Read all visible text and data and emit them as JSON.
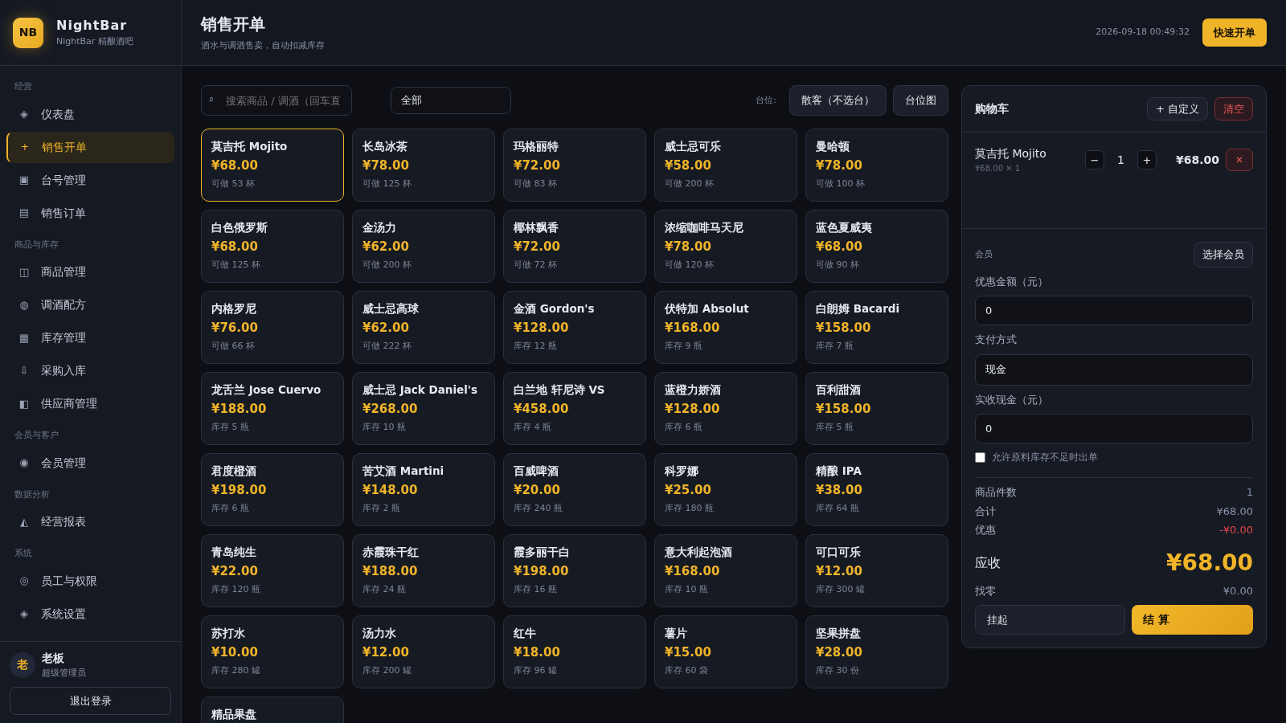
{
  "brand": {
    "logo": "NB",
    "name": "NightBar",
    "subtitle": "NightBar 精酿酒吧"
  },
  "sidebar": {
    "sections": [
      {
        "title": "经营",
        "items": [
          {
            "icon": "◈",
            "label": "仪表盘",
            "selected": false
          },
          {
            "icon": "+",
            "label": "销售开单",
            "selected": true
          },
          {
            "icon": "▣",
            "label": "台号管理",
            "selected": false
          },
          {
            "icon": "▤",
            "label": "销售订单",
            "selected": false
          }
        ]
      },
      {
        "title": "商品与库存",
        "items": [
          {
            "icon": "◫",
            "label": "商品管理",
            "selected": false
          },
          {
            "icon": "◍",
            "label": "调酒配方",
            "selected": false
          },
          {
            "icon": "▦",
            "label": "库存管理",
            "selected": false
          },
          {
            "icon": "⇩",
            "label": "采购入库",
            "selected": false
          },
          {
            "icon": "◧",
            "label": "供应商管理",
            "selected": false
          }
        ]
      },
      {
        "title": "会员与客户",
        "items": [
          {
            "icon": "◉",
            "label": "会员管理",
            "selected": false
          }
        ]
      },
      {
        "title": "数据分析",
        "items": [
          {
            "icon": "◭",
            "label": "经营报表",
            "selected": false
          }
        ]
      },
      {
        "title": "系统",
        "items": [
          {
            "icon": "◎",
            "label": "员工与权限",
            "selected": false
          },
          {
            "icon": "◈",
            "label": "系统设置",
            "selected": false
          }
        ]
      }
    ],
    "user": {
      "avatar": "老",
      "name": "老板",
      "role": "超级管理员"
    },
    "logout": "退出登录"
  },
  "header": {
    "title": "销售开单",
    "subtitle": "酒水与调酒售卖，自动扣减库存",
    "datetime": "2026-09-18 00:49:32",
    "action": "快速开单"
  },
  "toolbar": {
    "search_icon": "⌕",
    "search_placeholder": "搜索商品 / 调酒（回车直",
    "category": "全部",
    "table_label": "台位:",
    "table_value": "散客（不选台）",
    "table_map": "台位图"
  },
  "products": [
    {
      "name": "莫吉托 Mojito",
      "price": "¥68.00",
      "stock": "可做 53 杯",
      "selected": true
    },
    {
      "name": "长岛冰茶",
      "price": "¥78.00",
      "stock": "可做 125 杯",
      "selected": false
    },
    {
      "name": "玛格丽特",
      "price": "¥72.00",
      "stock": "可做 83 杯",
      "selected": false
    },
    {
      "name": "威士忌可乐",
      "price": "¥58.00",
      "stock": "可做 200 杯",
      "selected": false
    },
    {
      "name": "曼哈顿",
      "price": "¥78.00",
      "stock": "可做 100 杯",
      "selected": false
    },
    {
      "name": "白色俄罗斯",
      "price": "¥68.00",
      "stock": "可做 125 杯",
      "selected": false
    },
    {
      "name": "金汤力",
      "price": "¥62.00",
      "stock": "可做 200 杯",
      "selected": false
    },
    {
      "name": "椰林飘香",
      "price": "¥72.00",
      "stock": "可做 72 杯",
      "selected": false
    },
    {
      "name": "浓缩咖啡马天尼",
      "price": "¥78.00",
      "stock": "可做 120 杯",
      "selected": false
    },
    {
      "name": "蓝色夏威夷",
      "price": "¥68.00",
      "stock": "可做 90 杯",
      "selected": false
    },
    {
      "name": "内格罗尼",
      "price": "¥76.00",
      "stock": "可做 66 杯",
      "selected": false
    },
    {
      "name": "威士忌高球",
      "price": "¥62.00",
      "stock": "可做 222 杯",
      "selected": false
    },
    {
      "name": "金酒 Gordon's",
      "price": "¥128.00",
      "stock": "库存 12 瓶",
      "selected": false
    },
    {
      "name": "伏特加 Absolut",
      "price": "¥168.00",
      "stock": "库存 9 瓶",
      "selected": false
    },
    {
      "name": "白朗姆 Bacardi",
      "price": "¥158.00",
      "stock": "库存 7 瓶",
      "selected": false
    },
    {
      "name": "龙舌兰 Jose Cuervo",
      "price": "¥188.00",
      "stock": "库存 5 瓶",
      "selected": false
    },
    {
      "name": "威士忌 Jack Daniel's",
      "price": "¥268.00",
      "stock": "库存 10 瓶",
      "selected": false
    },
    {
      "name": "白兰地 轩尼诗 VS",
      "price": "¥458.00",
      "stock": "库存 4 瓶",
      "selected": false
    },
    {
      "name": "蓝橙力娇酒",
      "price": "¥128.00",
      "stock": "库存 6 瓶",
      "selected": false
    },
    {
      "name": "百利甜酒",
      "price": "¥158.00",
      "stock": "库存 5 瓶",
      "selected": false
    },
    {
      "name": "君度橙酒",
      "price": "¥198.00",
      "stock": "库存 6 瓶",
      "selected": false
    },
    {
      "name": "苦艾酒 Martini",
      "price": "¥148.00",
      "stock": "库存 2 瓶",
      "selected": false
    },
    {
      "name": "百威啤酒",
      "price": "¥20.00",
      "stock": "库存 240 瓶",
      "selected": false
    },
    {
      "name": "科罗娜",
      "price": "¥25.00",
      "stock": "库存 180 瓶",
      "selected": false
    },
    {
      "name": "精酿 IPA",
      "price": "¥38.00",
      "stock": "库存 64 瓶",
      "selected": false
    },
    {
      "name": "青岛纯生",
      "price": "¥22.00",
      "stock": "库存 120 瓶",
      "selected": false
    },
    {
      "name": "赤霞珠干红",
      "price": "¥188.00",
      "stock": "库存 24 瓶",
      "selected": false
    },
    {
      "name": "霞多丽干白",
      "price": "¥198.00",
      "stock": "库存 16 瓶",
      "selected": false
    },
    {
      "name": "意大利起泡酒",
      "price": "¥168.00",
      "stock": "库存 10 瓶",
      "selected": false
    },
    {
      "name": "可口可乐",
      "price": "¥12.00",
      "stock": "库存 300 罐",
      "selected": false
    },
    {
      "name": "苏打水",
      "price": "¥10.00",
      "stock": "库存 280 罐",
      "selected": false
    },
    {
      "name": "汤力水",
      "price": "¥12.00",
      "stock": "库存 200 罐",
      "selected": false
    },
    {
      "name": "红牛",
      "price": "¥18.00",
      "stock": "库存 96 罐",
      "selected": false
    },
    {
      "name": "薯片",
      "price": "¥15.00",
      "stock": "库存 60 袋",
      "selected": false
    },
    {
      "name": "坚果拼盘",
      "price": "¥28.00",
      "stock": "库存 30 份",
      "selected": false
    },
    {
      "name": "精品果盘",
      "selected": false
    }
  ],
  "cart": {
    "title": "购物车",
    "custom": "+ 自定义",
    "clear": "清空",
    "items": [
      {
        "name": "莫吉托 Mojito",
        "detail": "¥68.00 ✕ 1",
        "minus": "−",
        "qty": "1",
        "plus": "+",
        "total": "¥68.00",
        "remove": "✕"
      }
    ],
    "member_label": "会员",
    "member_button": "选择会员",
    "discount_label": "优惠金额（元）",
    "discount_value": "0",
    "payment_label": "支付方式",
    "payment_value": "现金",
    "cash_label": "实收现金（元）",
    "cash_value": "0",
    "allow_label": "允许原料库存不足时出单",
    "allow_checked": false,
    "summary": [
      {
        "label": "商品件数",
        "value": "1",
        "kind": "plain"
      },
      {
        "label": "合计",
        "value": "¥68.00",
        "kind": "plain"
      },
      {
        "label": "优惠",
        "value": "-¥0.00",
        "kind": "negative"
      },
      {
        "label": "应收",
        "value": "¥68.00",
        "kind": "due"
      },
      {
        "label": "找零",
        "value": "¥0.00",
        "kind": "plain"
      }
    ],
    "hold": "挂起",
    "checkout": "结 算"
  }
}
